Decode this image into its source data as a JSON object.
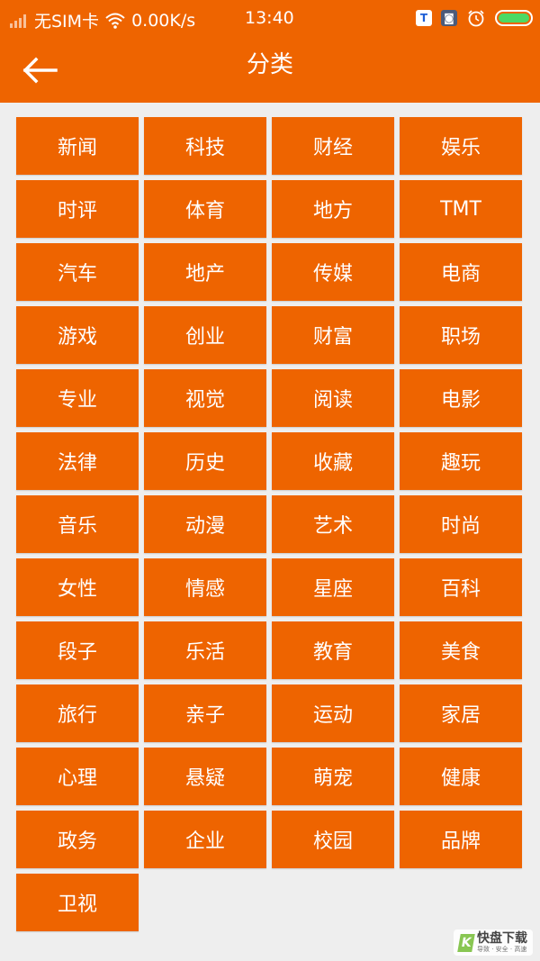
{
  "status_bar": {
    "carrier": "无SIM卡",
    "speed": "0.00K/s",
    "time": "13:40",
    "icons": [
      "signal-icon",
      "wifi-icon",
      "app-badge-icon",
      "app-badge-icon",
      "alarm-icon",
      "battery-icon"
    ],
    "battery_level": 1.0
  },
  "toolbar": {
    "title": "分类",
    "back_icon": "back-arrow-icon"
  },
  "categories": [
    "新闻",
    "科技",
    "财经",
    "娱乐",
    "时评",
    "体育",
    "地方",
    "TMT",
    "汽车",
    "地产",
    "传媒",
    "电商",
    "游戏",
    "创业",
    "财富",
    "职场",
    "专业",
    "视觉",
    "阅读",
    "电影",
    "法律",
    "历史",
    "收藏",
    "趣玩",
    "音乐",
    "动漫",
    "艺术",
    "时尚",
    "女性",
    "情感",
    "星座",
    "百科",
    "段子",
    "乐活",
    "教育",
    "美食",
    "旅行",
    "亲子",
    "运动",
    "家居",
    "心理",
    "悬疑",
    "萌宠",
    "健康",
    "政务",
    "企业",
    "校园",
    "品牌",
    "卫视"
  ],
  "watermark": {
    "logo_letter": "K",
    "main": "快盘下载",
    "sub": "导致 · 安全 · 高速"
  },
  "colors": {
    "accent": "#ee6400",
    "background": "#eeeeee",
    "text_on_accent": "#ffffff",
    "battery": "#4cd964"
  }
}
